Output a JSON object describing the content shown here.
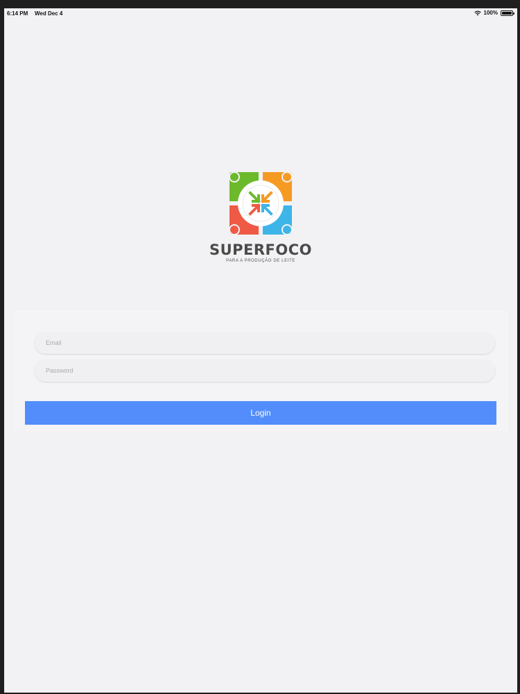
{
  "status_bar": {
    "time": "6:14 PM",
    "date": "Wed Dec 4",
    "battery_text": "100%",
    "battery_level": 1.0
  },
  "brand": {
    "name": "SUPERFOCO",
    "tagline": "PARA A PRODUÇÃO DE LEITE",
    "colors": {
      "green": "#6cba2b",
      "orange": "#f59a23",
      "red": "#ee5a45",
      "blue": "#3db5e8"
    }
  },
  "login_form": {
    "email_placeholder": "Email",
    "email_value": "",
    "password_placeholder": "Password",
    "password_value": "",
    "login_label": "Login",
    "accent_color": "#528dfb"
  },
  "icons": {
    "wifi": "wifi-icon",
    "battery": "battery-icon",
    "logo": "superfoco-logo-icon"
  }
}
